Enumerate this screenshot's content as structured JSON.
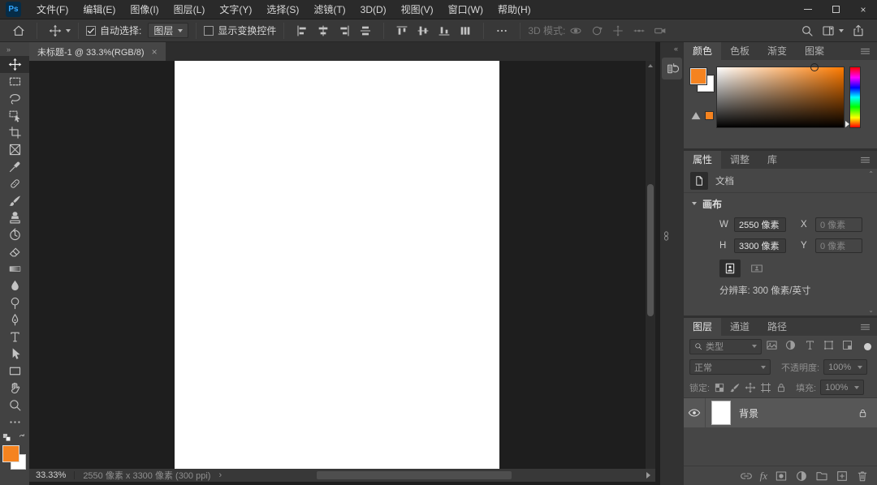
{
  "titlebar": {
    "app_badge": "Ps",
    "menus": [
      "文件(F)",
      "编辑(E)",
      "图像(I)",
      "图层(L)",
      "文字(Y)",
      "选择(S)",
      "滤镜(T)",
      "3D(D)",
      "视图(V)",
      "窗口(W)",
      "帮助(H)"
    ],
    "close_glyph": "×"
  },
  "options_bar": {
    "auto_select_label": "自动选择:",
    "auto_select_checked": true,
    "auto_select_value": "图层",
    "show_transform_label": "显示变换控件",
    "show_transform_checked": false,
    "mode_3d_label": "3D 模式:"
  },
  "document": {
    "tab_title": "未标题-1 @ 33.3%(RGB/8)",
    "tab_close_glyph": "×"
  },
  "status_bar": {
    "zoom_level": "33.33%",
    "doc_info": "2550 像素 x 3300 像素 (300 ppi)",
    "expand_glyph": "›"
  },
  "toolbar": {
    "collapse_glyph": "»",
    "foreground_color": "#f5831f",
    "background_color": "#ffffff",
    "tools": [
      "move",
      "rectangular-marquee",
      "lasso",
      "object-selection",
      "crop",
      "frame",
      "eyedropper",
      "spot-healing",
      "brush",
      "clone-stamp",
      "history-brush",
      "eraser",
      "gradient",
      "blur",
      "dodge",
      "pen",
      "type",
      "path-selection",
      "rectangle",
      "hand",
      "zoom"
    ],
    "selected_tool": "move"
  },
  "dock": {
    "collapse_glyph": "«"
  },
  "color_panel": {
    "tabs": [
      "颜色",
      "色板",
      "渐变",
      "图案"
    ],
    "active_tab": "颜色",
    "foreground_color": "#f5831f",
    "background_color": "#ffffff",
    "hue_color": "#ff7b00"
  },
  "properties_panel": {
    "tabs": [
      "属性",
      "调整",
      "库"
    ],
    "active_tab": "属性",
    "document_label": "文档",
    "canvas_label": "画布",
    "w_label": "W",
    "w_value": "2550 像素",
    "x_label": "X",
    "x_value": "0 像素",
    "h_label": "H",
    "h_value": "3300 像素",
    "y_label": "Y",
    "y_value": "0 像素",
    "resolution_text": "分辨率: 300 像素/英寸"
  },
  "layers_panel": {
    "tabs": [
      "图层",
      "通道",
      "路径"
    ],
    "active_tab": "图层",
    "filter_label": "类型",
    "blend_mode_value": "正常",
    "opacity_label": "不透明度:",
    "opacity_value": "100%",
    "lock_label": "锁定:",
    "fill_label": "填充:",
    "fill_value": "100%",
    "fx_glyph": "fx",
    "layers": [
      {
        "name": "背景",
        "visible": true,
        "locked": true
      }
    ]
  }
}
